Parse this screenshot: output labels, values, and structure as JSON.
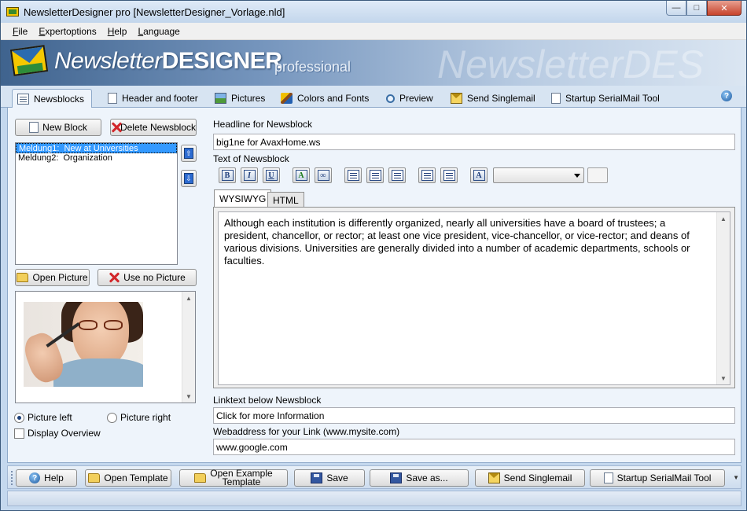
{
  "window": {
    "title": "NewsletterDesigner pro [NewsletterDesigner_Vorlage.nld]",
    "controls": {
      "minimize": "—",
      "maximize": "□",
      "close": "✕"
    }
  },
  "menu": {
    "file": {
      "u": "F",
      "rest": "ile"
    },
    "expertoptions": {
      "u": "E",
      "rest": "xpertoptions"
    },
    "help": {
      "u": "H",
      "rest": "elp"
    },
    "language": {
      "u": "L",
      "rest": "anguage"
    }
  },
  "banner": {
    "brand_light": "Newsletter",
    "brand_bold": "DESIGNER",
    "brand_sub": "professional",
    "ghost": "NewsletterDES"
  },
  "tabs": {
    "newsblocks": "Newsblocks",
    "header_footer": "Header and footer",
    "pictures": "Pictures",
    "colors_fonts": "Colors and Fonts",
    "preview": "Preview",
    "send_singlemail": "Send Singlemail",
    "startup_serialmail": "Startup SerialMail Tool",
    "help_icon": "?"
  },
  "left": {
    "new_block": "New Block",
    "delete_newsblock": "Delete Newsblock",
    "newsblocks": [
      {
        "label": "Meldung1:  New at Universities",
        "selected": true
      },
      {
        "label": "Meldung2:  Organization",
        "selected": false
      }
    ],
    "move_up": "⇧",
    "move_down": "⇩",
    "open_picture": "Open Picture",
    "use_no_picture": "Use no Picture",
    "picture_left": "Picture left",
    "picture_right": "Picture right",
    "display_overview": "Display Overview",
    "picture_position": "left",
    "display_overview_checked": false
  },
  "right": {
    "headline_label": "Headline for Newsblock",
    "headline_value": "big1ne for AvaxHome.ws",
    "text_label": "Text of Newsblock",
    "format_buttons": {
      "bold": "B",
      "italic": "I",
      "underline": "U",
      "font": "A",
      "link": "∞",
      "font_size": "A"
    },
    "editor_tabs": {
      "wysiwyg": "WYSIWYG",
      "html": "HTML"
    },
    "editor_text": "Although each institution is differently organized, nearly all universities have a board of trustees; a president, chancellor, or rector; at least one vice president, vice-chancellor, or vice-rector; and deans of various divisions. Universities are generally divided into a number of academic departments, schools or faculties.",
    "linktext_label": "Linktext below Newsblock",
    "linktext_value": "Click for more Information",
    "webaddress_label": "Webaddress for your Link (www.mysite.com)",
    "webaddress_value": "www.google.com"
  },
  "bottom": {
    "help": "Help",
    "open_template": "Open Template",
    "open_example_template_line1": "Open Example",
    "open_example_template_line2": "Template",
    "save": "Save",
    "save_as": "Save as...",
    "send_singlemail": "Send Singlemail",
    "startup_serialmail": "Startup SerialMail Tool"
  }
}
